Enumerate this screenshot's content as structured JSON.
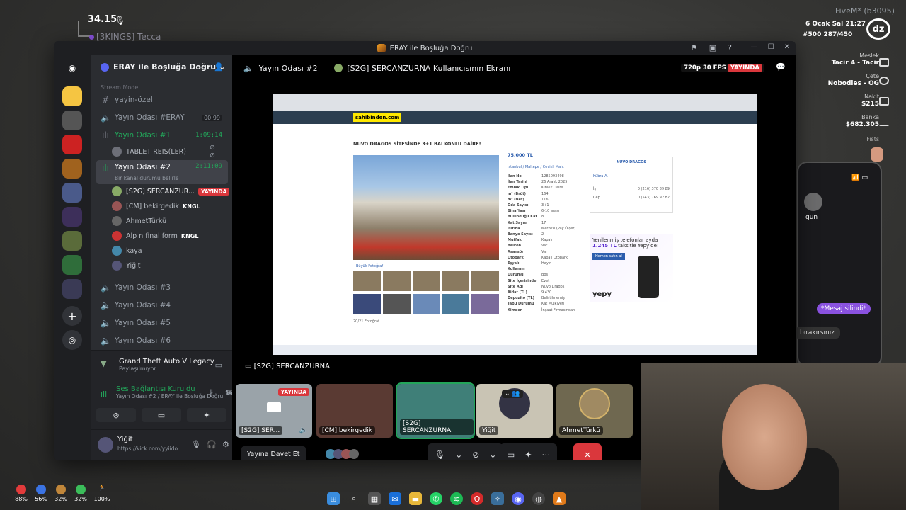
{
  "hud": {
    "timer": "34.15",
    "player_tag": "[3KINGS] Tecca",
    "server": "FiveM* (b3095)",
    "date": "6 Ocak Sal 21:27",
    "ids": "#500  287/450",
    "job_label": "Meslek",
    "job_value": "Tacir 4 - Tacir",
    "gang_label": "Çete",
    "gang_value": "Nobodies - OG",
    "cash_label": "Nakit",
    "cash_value": "$215",
    "bank_label": "Banka",
    "bank_value": "$682.305",
    "fists": "Fists",
    "message_deleted": "*Mesaj silindi*",
    "partial_text": "bırakırsınız",
    "partial_gun": "gun"
  },
  "stats": [
    {
      "value": "88%",
      "color": "#e23b3b"
    },
    {
      "value": "56%",
      "color": "#3b73e2"
    },
    {
      "value": "32%",
      "color": "#c0863a"
    },
    {
      "value": "32%",
      "color": "#3bbd5a"
    },
    {
      "value": "100%",
      "color": "#ffffff"
    }
  ],
  "window": {
    "title": "ERAY ile Boşluğa Doğru"
  },
  "server": {
    "name": "ERAY ile Boşluğa Doğru",
    "stream_mode": "Stream Mode"
  },
  "channels": {
    "ozel": "yayin-özel",
    "eray": "Yayın Odası #ERAY",
    "eray_counts": "00  99",
    "oda1": "Yayın Odası #1",
    "oda1_time": "1:09:14",
    "oda1_user": "TABLET REIS(LER)",
    "oda2": "Yayın Odası #2",
    "oda2_time": "2:11:09",
    "oda2_status": "Bir kanal durumu belirle",
    "users": [
      {
        "name": "[S2G] SERCANZUR...",
        "badge": "YAYINDA"
      },
      {
        "name": "[CM] bekirgedik",
        "badge": "KNGL"
      },
      {
        "name": "AhmetTürkü",
        "badge": ""
      },
      {
        "name": "Alp n final form",
        "badge": "KNGL"
      },
      {
        "name": "kaya",
        "badge": ""
      },
      {
        "name": "Yiğit",
        "badge": ""
      }
    ],
    "oda3": "Yayın Odası #3",
    "oda4": "Yayın Odası #4",
    "oda5": "Yayın Odası #5",
    "oda6": "Yayın Odası #6"
  },
  "game": {
    "title": "Grand Theft Auto V Legacy",
    "status": "Paylaşılmıyor"
  },
  "voice": {
    "status": "Ses Bağlantısı Kuruldu",
    "channel": "Yayın Odası #2 / ERAY ile Boşluğa Doğru"
  },
  "me": {
    "name": "Yiğit",
    "status": "https://kick.com/yyiido"
  },
  "stage": {
    "channel": "Yayın Odası #2",
    "screen_title": "[S2G] SERCANZURNA Kullanıcısının Ekranı",
    "quality": "720p 30 FPS",
    "live": "YAYINDA",
    "streamer_tag": "[S2G] SERCANZURNA",
    "invite": "Yayına Davet Et"
  },
  "listing": {
    "logo": "sahibinden.com",
    "title": "NUVO DRAGOS SİTESİNDE 3+1 BALKONLU DAİRE!",
    "price": "75.000 TL",
    "location": "İstanbul / Maltepe / Cevizli Mah.",
    "gallery": "Büyük Fotoğraf",
    "photo_count": "20/21 Fotoğraf",
    "specs": [
      {
        "k": "İlan No",
        "v": "1285093498"
      },
      {
        "k": "İlan Tarihi",
        "v": "26 Aralık 2025"
      },
      {
        "k": "Emlak Tipi",
        "v": "Kiralık Daire"
      },
      {
        "k": "m² (Brüt)",
        "v": "164"
      },
      {
        "k": "m² (Net)",
        "v": "116"
      },
      {
        "k": "Oda Sayısı",
        "v": "3+1"
      },
      {
        "k": "Bina Yaşı",
        "v": "6-10 arası"
      },
      {
        "k": "Bulunduğu Kat",
        "v": "8"
      },
      {
        "k": "Kat Sayısı",
        "v": "17"
      },
      {
        "k": "Isıtma",
        "v": "Merkezi (Pay Ölçer)"
      },
      {
        "k": "Banyo Sayısı",
        "v": "2"
      },
      {
        "k": "Mutfak",
        "v": "Kapalı"
      },
      {
        "k": "Balkon",
        "v": "Var"
      },
      {
        "k": "Asansör",
        "v": "Var"
      },
      {
        "k": "Otopark",
        "v": "Kapalı Otopark"
      },
      {
        "k": "Eşyalı",
        "v": "Hayır"
      },
      {
        "k": "Kullanım Durumu",
        "v": "Boş"
      },
      {
        "k": "Site İçerisinde",
        "v": "Evet"
      },
      {
        "k": "Site Adı",
        "v": "Nuvo Dragos"
      },
      {
        "k": "Aidat (TL)",
        "v": "9.430"
      },
      {
        "k": "Depozito (TL)",
        "v": "Belirtilmemiş"
      },
      {
        "k": "Tapu Durumu",
        "v": "Kat Mülkiyeti"
      },
      {
        "k": "Kimden",
        "v": "İnşaat Firmasından"
      }
    ],
    "agency": "NUVO DRAGOS",
    "agent": "Kübra A.",
    "phone_is": "0 (216) 370 89 89",
    "phone_cep": "0 (543) 769 92 82",
    "is_label": "İş",
    "cep_label": "Cep",
    "ad_text": "Yenilenmiş telefonlar ayda",
    "ad_price": "1.245 TL",
    "ad_suffix": "taksitle Yepy'de!",
    "ad_button": "Hemen satın al",
    "ad_brand": "yepy"
  },
  "tiles": [
    {
      "label": "[S2G] SER...",
      "badge": "YAYINDA"
    },
    {
      "label": "[CM] bekirgedik",
      "badge": ""
    },
    {
      "label": "[S2G] SERCANZURNA",
      "badge": ""
    },
    {
      "label": "Yiğit",
      "badge": ""
    },
    {
      "label": "AhmetTürkü",
      "badge": ""
    }
  ]
}
